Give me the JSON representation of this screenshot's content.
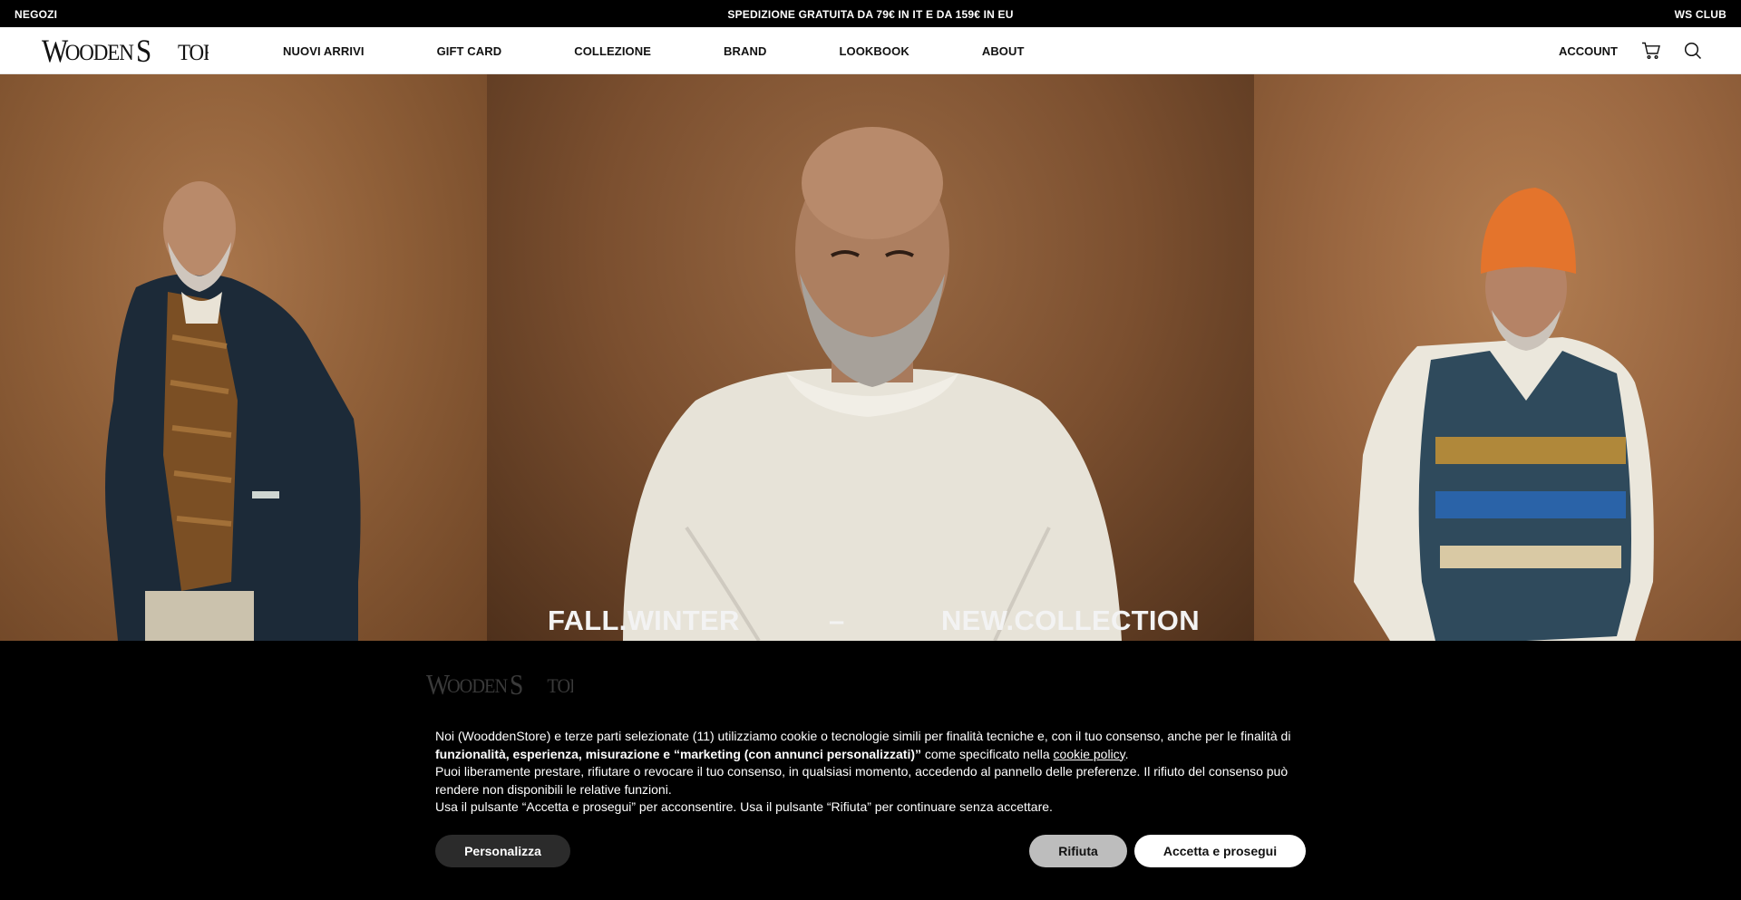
{
  "topbar": {
    "left": "NEGOZI",
    "center": "SPEDIZIONE GRATUITA DA 79€ IN IT E DA 159€ IN EU",
    "right": "WS CLUB"
  },
  "header": {
    "logo_text": "WoodenStore",
    "nav": [
      "NUOVI ARRIVI",
      "GIFT CARD",
      "COLLEZIONE",
      "BRAND",
      "LOOKBOOK",
      "ABOUT"
    ],
    "account": "ACCOUNT",
    "icons": [
      "cart-icon",
      "search-icon"
    ]
  },
  "hero": {
    "caption_left": "FALL.WINTER",
    "caption_sep": "–",
    "caption_right": "NEW.COLLECTION"
  },
  "cookie": {
    "logo_text": "WoodenStore",
    "line1_a": "Noi (WooddenStore) e terze parti selezionate (11) utilizziamo cookie o tecnologie simili per finalità tecniche e, con il tuo consenso, anche per le finalità di",
    "line1_bold": "funzionalità, esperienza, misurazione e “marketing (con annunci personalizzati)”",
    "line1_b": " come specificato nella ",
    "line1_link": "cookie policy",
    "line1_end": ".",
    "line2": "Puoi liberamente prestare, rifiutare o revocare il tuo consenso, in qualsiasi momento, accedendo al pannello delle preferenze. Il rifiuto del consenso può rendere non disponibili le relative funzioni.",
    "line3": "Usa il pulsante “Accetta e prosegui” per acconsentire. Usa il pulsante “Rifiuta” per continuare senza accettare.",
    "btn_customize": "Personalizza",
    "btn_reject": "Rifiuta",
    "btn_accept": "Accetta e prosegui"
  },
  "colors": {
    "topbar_bg": "#000000",
    "hero_bg": "#8a5a35",
    "btn_reject_bg": "#bdbdbd",
    "btn_custom_bg": "#2b2b2b"
  }
}
